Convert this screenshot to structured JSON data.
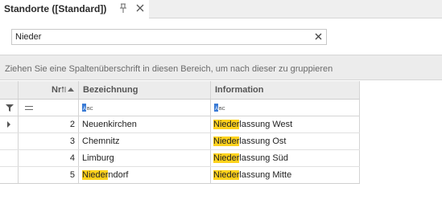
{
  "tab": {
    "title": "Standorte ([Standard])"
  },
  "search": {
    "value": "Nieder"
  },
  "group_panel": {
    "text": "Ziehen Sie eine Spaltenüberschrift in diesen Bereich, um nach dieser zu gruppieren"
  },
  "grid": {
    "columns": {
      "nr": "Nr",
      "bezeichnung": "Bezeichnung",
      "information": "Information"
    },
    "rows": [
      {
        "nr": "2",
        "bez_pre": "",
        "bez_hl": "",
        "bez_post": "Neuenkirchen",
        "info_hl": "Nieder",
        "info_post": "lassung West"
      },
      {
        "nr": "3",
        "bez_pre": "",
        "bez_hl": "",
        "bez_post": "Chemnitz",
        "info_hl": "Nieder",
        "info_post": "lassung Ost"
      },
      {
        "nr": "4",
        "bez_pre": "",
        "bez_hl": "",
        "bez_post": "Limburg",
        "info_hl": "Nieder",
        "info_post": "lassung Süd"
      },
      {
        "nr": "5",
        "bez_pre": "",
        "bez_hl": "Nieder",
        "bez_post": "ndorf",
        "info_hl": "Nieder",
        "info_post": "lassung Mitte"
      }
    ]
  },
  "colors": {
    "highlight": "#ffd21c"
  }
}
